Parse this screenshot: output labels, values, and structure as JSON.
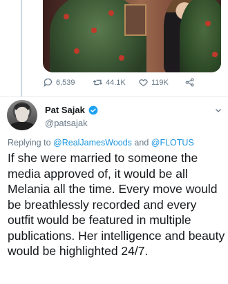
{
  "previous_tweet": {
    "photo_alt": "",
    "stats": {
      "replies": "6,539",
      "retweets": "44.1K",
      "likes": "119K"
    }
  },
  "tweet": {
    "author_name": "Pat Sajak",
    "author_handle": "@patsajak",
    "verified": true,
    "reply_prefix": "Replying to",
    "reply_to_1": "@RealJamesWoods",
    "reply_and": "and",
    "reply_to_2": "@FLOTUS",
    "text": "If she were married to someone the media approved of, it would be all Melania all the time. Every move would be breathlessly recorded and every outfit would be featured in multiple publications. Her intelligence and beauty would be highlighted 24/7."
  },
  "colors": {
    "link": "#1b95e0",
    "secondary_text": "#657786",
    "verified": "#1da1f2"
  }
}
